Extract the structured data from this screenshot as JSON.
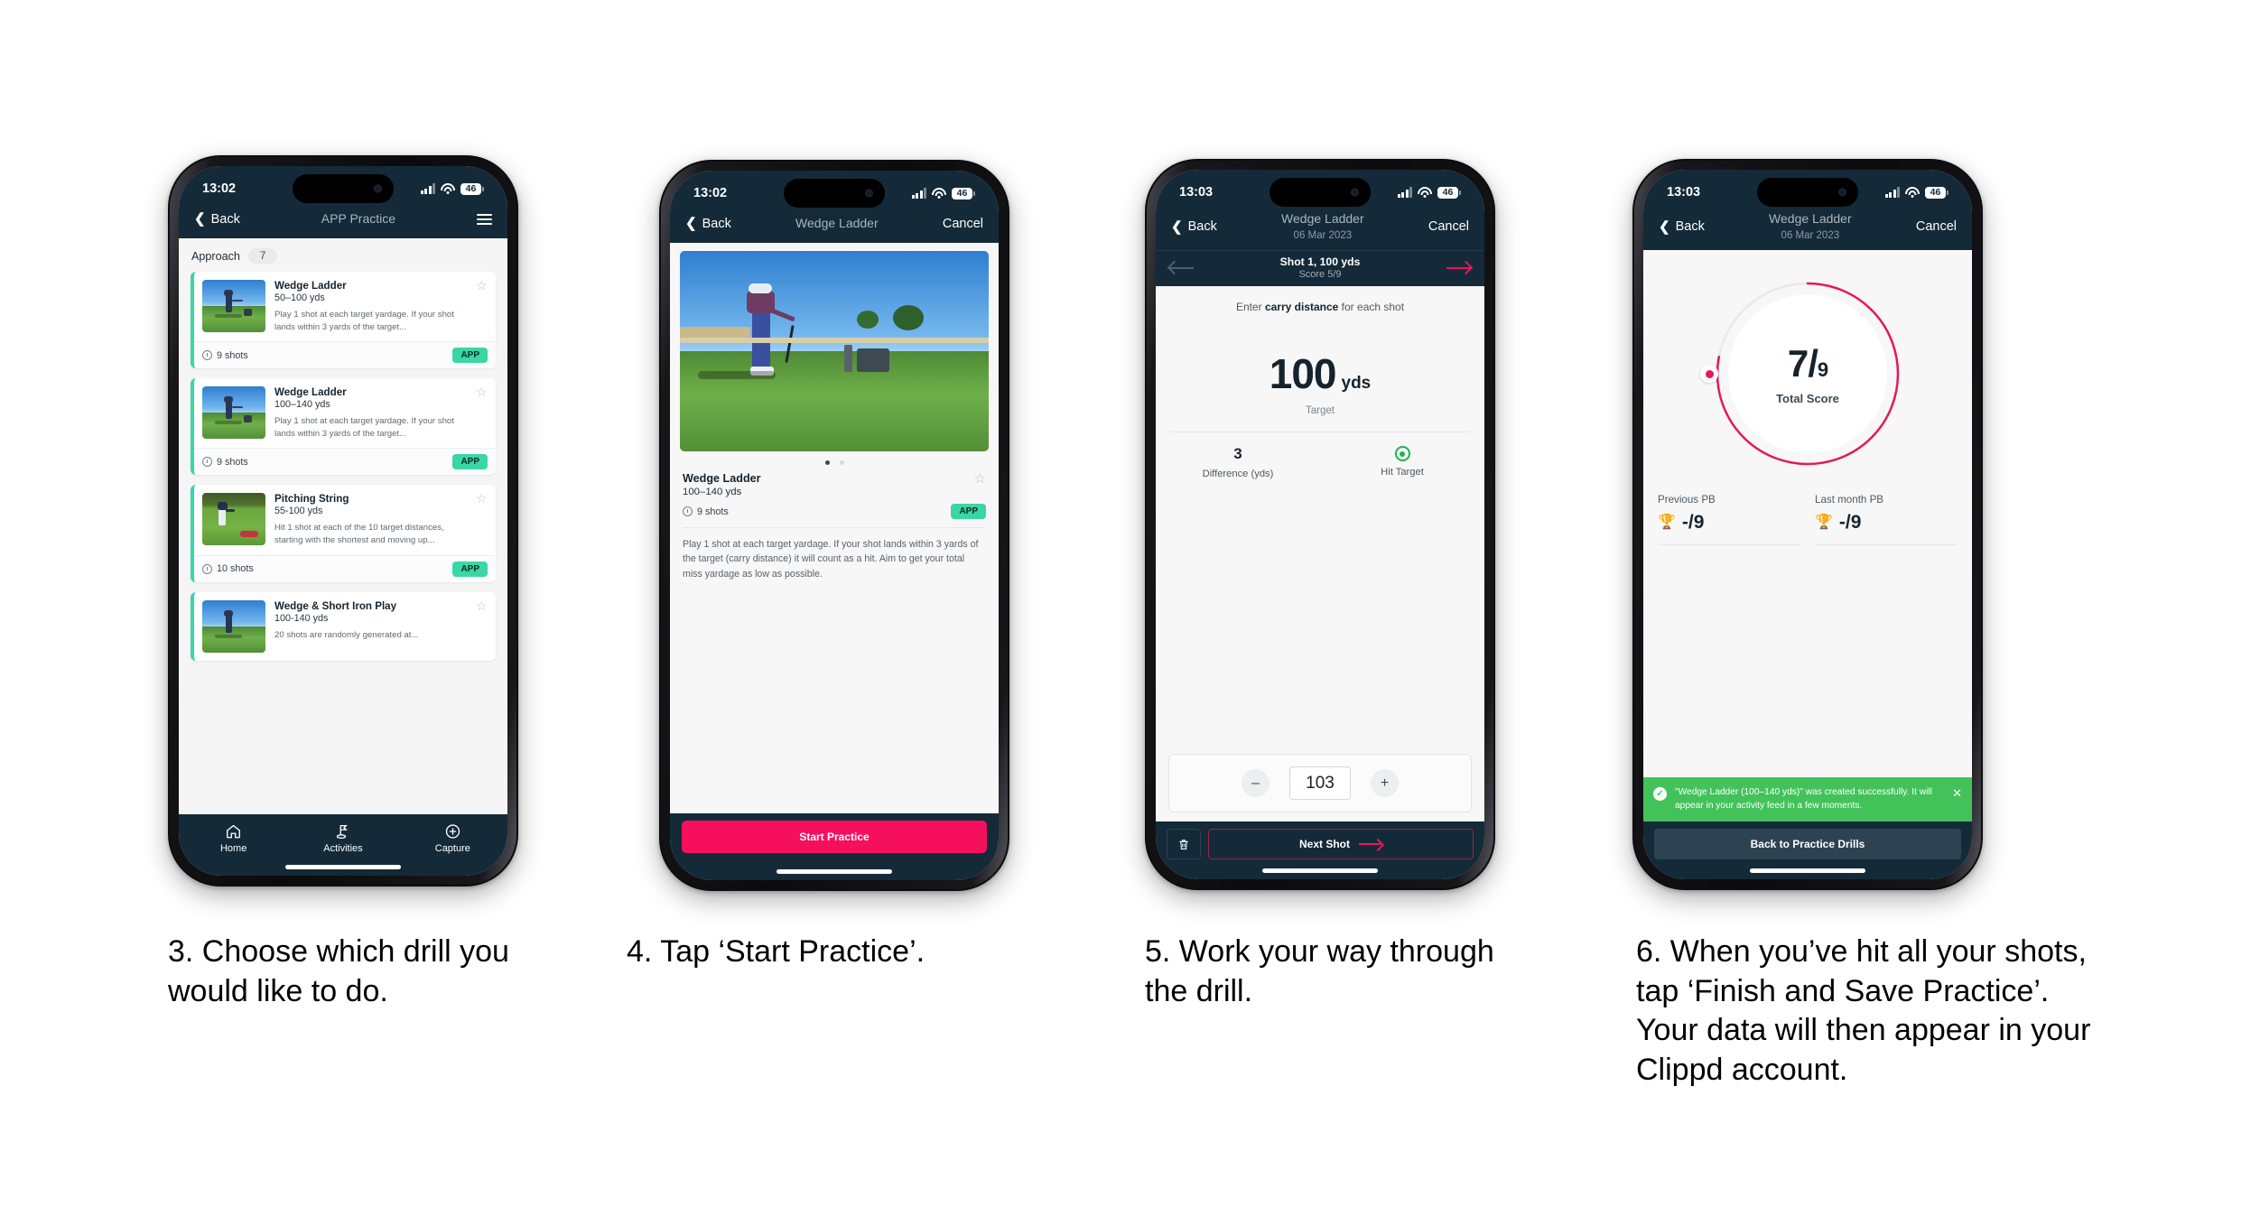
{
  "colors": {
    "navy": "#142a38",
    "pink": "#f50f5c",
    "mint": "#3ad6a4",
    "green": "#43c25a",
    "crimson": "#e6175c"
  },
  "phones": [
    {
      "id": "phone-1",
      "status": {
        "time": "13:02",
        "battery": "46"
      },
      "nav": {
        "back": "Back",
        "title": "APP Practice",
        "menu_icon": "hamburger-icon"
      },
      "section": {
        "label": "Approach",
        "count": "7"
      },
      "cards": [
        {
          "title": "Wedge Ladder",
          "yardage": "50–100 yds",
          "description": "Play 1 shot at each target yardage. If your shot lands within 3 yards of the target...",
          "shots": "9 shots",
          "tag": "APP"
        },
        {
          "title": "Wedge Ladder",
          "yardage": "100–140 yds",
          "description": "Play 1 shot at each target yardage. If your shot lands within 3 yards of the target...",
          "shots": "9 shots",
          "tag": "APP"
        },
        {
          "title": "Pitching String",
          "yardage": "55-100 yds",
          "description": "Hit 1 shot at each of the 10 target distances, starting with the shortest and moving up...",
          "shots": "10 shots",
          "tag": "APP"
        },
        {
          "title": "Wedge & Short Iron Play",
          "yardage": "100-140 yds",
          "description": "20 shots are randomly generated at...",
          "shots": "",
          "tag": ""
        }
      ],
      "tabs": [
        {
          "label": "Home",
          "icon": "home-icon"
        },
        {
          "label": "Activities",
          "icon": "golf-flag-icon"
        },
        {
          "label": "Capture",
          "icon": "plus-circle-icon"
        }
      ]
    },
    {
      "id": "phone-2",
      "status": {
        "time": "13:02",
        "battery": "46"
      },
      "nav": {
        "back": "Back",
        "title": "Wedge Ladder",
        "cancel": "Cancel"
      },
      "detail": {
        "title": "Wedge Ladder",
        "yardage": "100–140 yds",
        "shots": "9 shots",
        "tag": "APP",
        "description": "Play 1 shot at each target yardage. If your shot lands within 3 yards of the target (carry distance) it will count as a hit. Aim to get your total miss yardage as low as possible."
      },
      "cta": "Start Practice"
    },
    {
      "id": "phone-3",
      "status": {
        "time": "13:03",
        "battery": "46"
      },
      "nav": {
        "back": "Back",
        "title": "Wedge Ladder",
        "date": "06 Mar 2023",
        "cancel": "Cancel"
      },
      "shotbar": {
        "title": "Shot 1, 100 yds",
        "score": "Score 5/9"
      },
      "prompt_pre": "Enter ",
      "prompt_bold": "carry distance",
      "prompt_post": " for each shot",
      "target": {
        "value": "100",
        "unit": "yds",
        "caption": "Target"
      },
      "stats": [
        {
          "value": "3",
          "label": "Difference (yds)"
        },
        {
          "value": "",
          "label": "Hit Target",
          "icon": "target-dot-icon"
        }
      ],
      "stepper": {
        "minus": "–",
        "value": "103",
        "plus": "+"
      },
      "footer": {
        "delete_icon": "trash-icon",
        "next": "Next Shot"
      }
    },
    {
      "id": "phone-4",
      "status": {
        "time": "13:03",
        "battery": "46"
      },
      "nav": {
        "back": "Back",
        "title": "Wedge Ladder",
        "date": "06 Mar 2023",
        "cancel": "Cancel"
      },
      "ring": {
        "score": "7",
        "slash": "/",
        "denominator": "9",
        "label": "Total Score",
        "percent": 78
      },
      "pbs": [
        {
          "label": "Previous PB",
          "value": "-/9",
          "icon": "trophy-icon"
        },
        {
          "label": "Last month PB",
          "value": "-/9",
          "icon": "trophy-icon"
        }
      ],
      "toast": {
        "message": "\"Wedge Ladder (100–140 yds)\" was created successfully. It will appear in your activity feed in a few moments.",
        "close_icon": "close-icon",
        "check_icon": "check-icon"
      },
      "footer_button": "Back to Practice Drills"
    }
  ],
  "captions": [
    "3. Choose which drill you would like to do.",
    "4. Tap ‘Start Practice’.",
    "5. Work your way through the drill.",
    "6. When you’ve hit all your shots, tap ‘Finish and Save Practice’. Your data will then appear in your Clippd account."
  ]
}
